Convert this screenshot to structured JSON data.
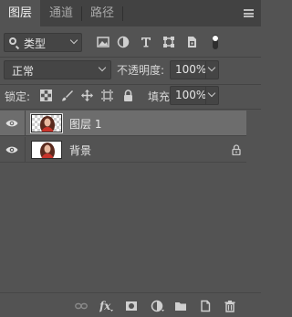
{
  "tabs": [
    {
      "label": "图层",
      "active": true
    },
    {
      "label": "通道",
      "active": false
    },
    {
      "label": "路径",
      "active": false
    }
  ],
  "filter": {
    "kind_label": "类型",
    "icons": [
      "image-filter-icon",
      "adjustment-filter-icon",
      "type-filter-icon",
      "shape-filter-icon",
      "smartobject-filter-icon",
      "filter-toggle-icon"
    ]
  },
  "blend": {
    "mode": "正常",
    "opacity_label": "不透明度:",
    "opacity_value": "100%"
  },
  "lock": {
    "label": "锁定:",
    "icons": [
      "lock-transparent-pixels-icon",
      "lock-image-pixels-icon",
      "lock-position-icon",
      "lock-artboard-icon",
      "lock-all-icon"
    ],
    "fill_label": "填充:",
    "fill_value": "100%"
  },
  "layers": [
    {
      "name": "图层 1",
      "visible": true,
      "selected": true,
      "locked": false
    },
    {
      "name": "背景",
      "visible": true,
      "selected": false,
      "locked": true
    }
  ],
  "toolbar": {
    "icons": [
      "link-layers-icon",
      "fx-icon",
      "add-mask-icon",
      "new-adjustment-icon",
      "new-group-icon",
      "new-layer-icon",
      "trash-icon"
    ]
  },
  "colors": {
    "panel_bg": "#535353",
    "tabbar_bg": "#424242",
    "selected_row": "#6d6d6d",
    "field_bg": "#454545"
  }
}
